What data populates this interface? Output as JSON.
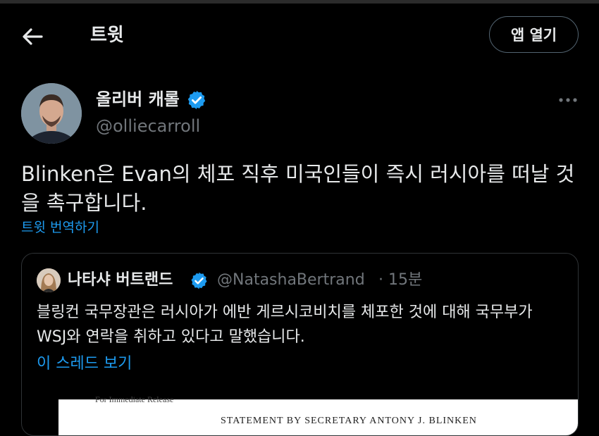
{
  "header": {
    "title": "트윗",
    "open_app_label": "앱 열기"
  },
  "tweet": {
    "author_name": "올리버 캐롤",
    "handle": "@olliecarroll",
    "verified": true,
    "text": "Blinken은 Evan의 체포 직후 미국인들이 즉시 러시아를 떠날 것을 촉구합니다.",
    "translate_label": "트윗 번역하기"
  },
  "quoted_tweet": {
    "author_name": "나타샤 버트랜드",
    "handle": "@NatashaBertrand",
    "separator": "·",
    "time": "15분",
    "verified": true,
    "text": "블링컨 국무장관은 러시아가 에반 게르시코비치를 체포한 것에 대해 국무부가 WSJ와 연락을 취하고 있다고 말했습니다.",
    "show_thread_label": "이 스레드 보기",
    "image_top_text": "For Immediate Release",
    "image_heading": "STATEMENT BY SECRETARY ANTONY J. BLINKEN"
  },
  "icons": {
    "back": "arrow-left-icon",
    "verified": "verified-badge-icon",
    "more": "more-horizontal-icon"
  },
  "colors": {
    "background": "#000000",
    "text": "#e7e9ea",
    "secondary": "#71767b",
    "accent": "#1d9bf0",
    "border": "#2f3336"
  }
}
